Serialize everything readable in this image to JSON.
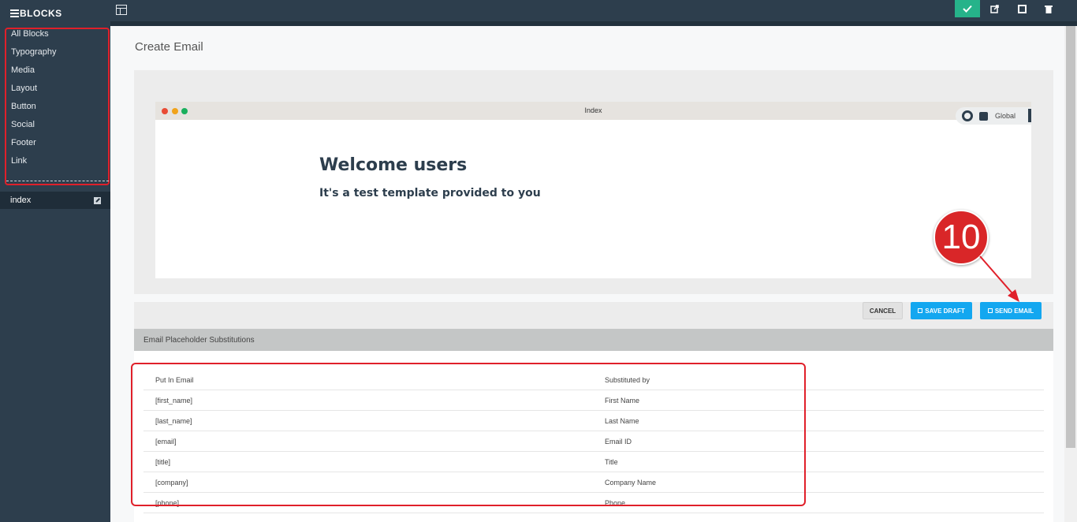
{
  "sidebar": {
    "title": "BLOCKS",
    "items": [
      {
        "label": "All Blocks"
      },
      {
        "label": "Typography"
      },
      {
        "label": "Media"
      },
      {
        "label": "Layout"
      },
      {
        "label": "Button"
      },
      {
        "label": "Social"
      },
      {
        "label": "Footer"
      },
      {
        "label": "Link"
      }
    ],
    "page": {
      "label": "index"
    }
  },
  "toolbar": {
    "icons": [
      "grid-icon",
      "check-icon",
      "external-link-icon",
      "square-icon",
      "trash-icon"
    ]
  },
  "main": {
    "title": "Create Email",
    "browser": {
      "title": "Index",
      "global_label": "Global",
      "heading": "Welcome users",
      "subheading": "It's a test  template provided to you"
    },
    "actions": {
      "cancel": "CANCEL",
      "save_draft": "SAVE DRAFT",
      "send_email": "SEND EMAIL"
    },
    "annotation_number": "10",
    "placeholders": {
      "header": "Email Placeholder Substitutions",
      "columns": [
        "Put In Email",
        "Substituted by"
      ],
      "rows": [
        [
          "[first_name]",
          "First Name"
        ],
        [
          "[last_name]",
          "Last Name"
        ],
        [
          "[email]",
          "Email ID"
        ],
        [
          "[title]",
          "Title"
        ],
        [
          "[company]",
          "Company Name"
        ],
        [
          "[phone]",
          "Phone"
        ]
      ]
    }
  },
  "colors": {
    "sidebar_bg": "#2d3e4d",
    "accent_green": "#26b38a",
    "accent_blue": "#13a7f0",
    "highlight_red": "#e0202a"
  }
}
